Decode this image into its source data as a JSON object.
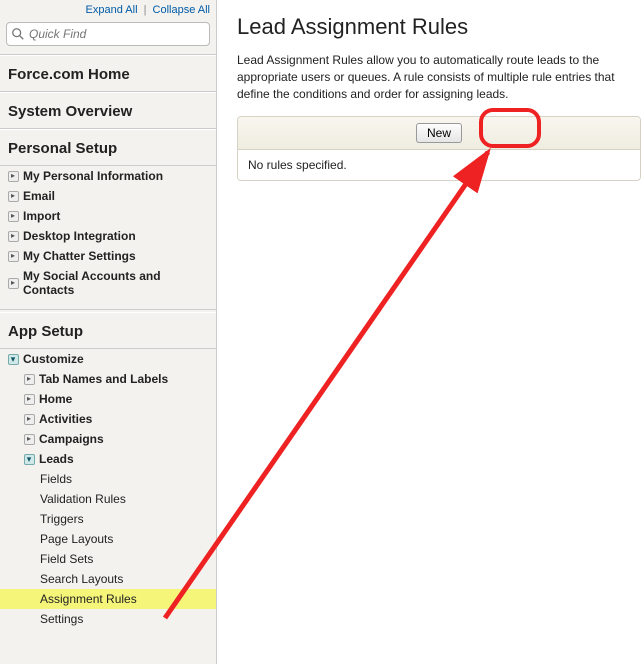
{
  "topLinks": {
    "expand": "Expand All",
    "collapse": "Collapse All",
    "sep": "|"
  },
  "search": {
    "placeholder": "Quick Find"
  },
  "homeLink": "Force.com Home",
  "systemOverview": "System Overview",
  "personalSetup": {
    "title": "Personal Setup",
    "items": [
      "My Personal Information",
      "Email",
      "Import",
      "Desktop Integration",
      "My Chatter Settings",
      "My Social Accounts and Contacts"
    ]
  },
  "appSetup": {
    "title": "App Setup",
    "customize": "Customize",
    "customizeItems": [
      "Tab Names and Labels",
      "Home",
      "Activities",
      "Campaigns"
    ],
    "leads": "Leads",
    "leadsItems": [
      "Fields",
      "Validation Rules",
      "Triggers",
      "Page Layouts",
      "Field Sets",
      "Search Layouts",
      "Assignment Rules",
      "Settings"
    ]
  },
  "main": {
    "title": "Lead Assignment Rules",
    "desc": "Lead Assignment Rules allow you to automatically route leads to the appropriate users or queues. A rule consists of multiple rule entries that define the conditions and order for assigning leads.",
    "newButton": "New",
    "empty": "No rules specified."
  }
}
